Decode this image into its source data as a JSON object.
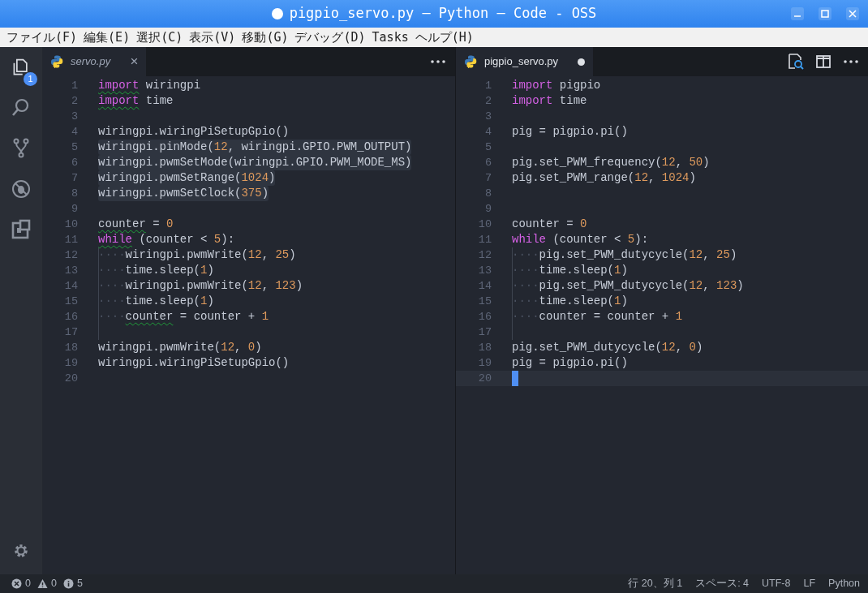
{
  "window": {
    "title": "pigpio_servo.py — Python — Code - OSS",
    "dirty": true
  },
  "menu": [
    "ファイル(F)",
    "編集(E)",
    "選択(C)",
    "表示(V)",
    "移動(G)",
    "デバッグ(D)",
    "Tasks",
    "ヘルプ(H)"
  ],
  "activity_bar": {
    "items": [
      {
        "kind": "files",
        "selected": true,
        "badge": "1"
      },
      {
        "kind": "search",
        "selected": false
      },
      {
        "kind": "source-control",
        "selected": false
      },
      {
        "kind": "debug",
        "selected": false
      },
      {
        "kind": "extensions",
        "selected": false
      }
    ],
    "bottom": {
      "kind": "settings"
    }
  },
  "editors": [
    {
      "tab": {
        "label": "servo.py",
        "preview": true,
        "dirty": false,
        "close": "×"
      },
      "actions": [
        {
          "kind": "more"
        }
      ],
      "lines": [
        {
          "number": "1",
          "highlighted": false,
          "current": false,
          "guide": false,
          "tokens": [
            {
              "text": "import",
              "kind": "keyword",
              "warning": true
            },
            {
              "text": " wiringpi",
              "kind": "plain",
              "warning": false
            }
          ]
        },
        {
          "number": "2",
          "highlighted": false,
          "current": false,
          "guide": false,
          "tokens": [
            {
              "text": "import",
              "kind": "keyword",
              "warning": true
            },
            {
              "text": " time",
              "kind": "plain",
              "warning": false
            }
          ]
        },
        {
          "number": "3",
          "highlighted": false,
          "current": false,
          "guide": false
        },
        {
          "number": "4",
          "highlighted": false,
          "current": false,
          "guide": false,
          "tokens": [
            {
              "text": "wiringpi.wiringPiSetupGpio()",
              "kind": "plain",
              "warning": false
            }
          ]
        },
        {
          "number": "5",
          "highlighted": true,
          "current": false,
          "guide": false,
          "tokens": [
            {
              "text": "wiringpi.pinMode(",
              "kind": "plain",
              "warning": false
            },
            {
              "text": "12",
              "kind": "number",
              "warning": false
            },
            {
              "text": ", wiringpi.GPIO.PWM_OUTPUT)",
              "kind": "plain",
              "warning": false
            }
          ]
        },
        {
          "number": "6",
          "highlighted": true,
          "current": false,
          "guide": false,
          "tokens": [
            {
              "text": "wiringpi.pwmSetMode(wiringpi.GPIO.PWM_MODE_MS)",
              "kind": "plain",
              "warning": false
            }
          ]
        },
        {
          "number": "7",
          "highlighted": true,
          "current": false,
          "guide": false,
          "tokens": [
            {
              "text": "wiringpi.pwmSetRange(",
              "kind": "plain",
              "warning": false
            },
            {
              "text": "1024",
              "kind": "number",
              "warning": false
            },
            {
              "text": ")",
              "kind": "plain",
              "warning": false
            }
          ]
        },
        {
          "number": "8",
          "highlighted": true,
          "current": false,
          "guide": false,
          "tokens": [
            {
              "text": "wiringpi.pwmSetClock(",
              "kind": "plain",
              "warning": false
            },
            {
              "text": "375",
              "kind": "number",
              "warning": false
            },
            {
              "text": ")",
              "kind": "plain",
              "warning": false
            }
          ]
        },
        {
          "number": "9",
          "highlighted": false,
          "current": false,
          "guide": false
        },
        {
          "number": "10",
          "highlighted": false,
          "current": false,
          "guide": false,
          "tokens": [
            {
              "text": "counter",
              "kind": "plain",
              "warning": true
            },
            {
              "text": " = ",
              "kind": "plain",
              "warning": false
            },
            {
              "text": "0",
              "kind": "number",
              "warning": false
            }
          ]
        },
        {
          "number": "11",
          "highlighted": false,
          "current": false,
          "guide": false,
          "tokens": [
            {
              "text": "while",
              "kind": "keyword",
              "warning": true
            },
            {
              "text": " (counter < ",
              "kind": "plain",
              "warning": false
            },
            {
              "text": "5",
              "kind": "number",
              "warning": false
            },
            {
              "text": "):",
              "kind": "plain",
              "warning": false
            }
          ]
        },
        {
          "number": "12",
          "highlighted": false,
          "current": false,
          "guide": true,
          "tokens": [
            {
              "text": "····",
              "kind": "whitespace",
              "warning": false
            },
            {
              "text": "wiringpi.pwmWrite(",
              "kind": "plain",
              "warning": false
            },
            {
              "text": "12",
              "kind": "number",
              "warning": false
            },
            {
              "text": ", ",
              "kind": "plain",
              "warning": false
            },
            {
              "text": "25",
              "kind": "number",
              "warning": false
            },
            {
              "text": ")",
              "kind": "plain",
              "warning": false
            }
          ]
        },
        {
          "number": "13",
          "highlighted": false,
          "current": false,
          "guide": true,
          "tokens": [
            {
              "text": "····",
              "kind": "whitespace",
              "warning": false
            },
            {
              "text": "time.sleep(",
              "kind": "plain",
              "warning": false
            },
            {
              "text": "1",
              "kind": "number",
              "warning": false
            },
            {
              "text": ")",
              "kind": "plain",
              "warning": false
            }
          ]
        },
        {
          "number": "14",
          "highlighted": false,
          "current": false,
          "guide": true,
          "tokens": [
            {
              "text": "····",
              "kind": "whitespace",
              "warning": false
            },
            {
              "text": "wiringpi.pwmWrite(",
              "kind": "plain",
              "warning": false
            },
            {
              "text": "12",
              "kind": "number",
              "warning": false
            },
            {
              "text": ", ",
              "kind": "plain",
              "warning": false
            },
            {
              "text": "123",
              "kind": "number",
              "warning": false
            },
            {
              "text": ")",
              "kind": "plain",
              "warning": false
            }
          ]
        },
        {
          "number": "15",
          "highlighted": false,
          "current": false,
          "guide": true,
          "tokens": [
            {
              "text": "····",
              "kind": "whitespace",
              "warning": false
            },
            {
              "text": "time.sleep(",
              "kind": "plain",
              "warning": false
            },
            {
              "text": "1",
              "kind": "number",
              "warning": false
            },
            {
              "text": ")",
              "kind": "plain",
              "warning": false
            }
          ]
        },
        {
          "number": "16",
          "highlighted": false,
          "current": false,
          "guide": true,
          "tokens": [
            {
              "text": "····",
              "kind": "whitespace",
              "warning": false
            },
            {
              "text": "counter",
              "kind": "plain",
              "warning": true
            },
            {
              "text": " = counter + ",
              "kind": "plain",
              "warning": false
            },
            {
              "text": "1",
              "kind": "number",
              "warning": false
            }
          ]
        },
        {
          "number": "17",
          "highlighted": false,
          "current": false,
          "guide": true
        },
        {
          "number": "18",
          "highlighted": false,
          "current": false,
          "guide": false,
          "tokens": [
            {
              "text": "wiringpi.pwmWrite(",
              "kind": "plain",
              "warning": false
            },
            {
              "text": "12",
              "kind": "number",
              "warning": false
            },
            {
              "text": ", ",
              "kind": "plain",
              "warning": false
            },
            {
              "text": "0",
              "kind": "number",
              "warning": false
            },
            {
              "text": ")",
              "kind": "plain",
              "warning": false
            }
          ]
        },
        {
          "number": "19",
          "highlighted": false,
          "current": false,
          "guide": false,
          "tokens": [
            {
              "text": "wiringpi.wiringPiSetupGpio()",
              "kind": "plain",
              "warning": false
            }
          ]
        },
        {
          "number": "20",
          "highlighted": false,
          "current": false,
          "guide": false
        }
      ]
    },
    {
      "tab": {
        "label": "pigpio_servo.py",
        "preview": false,
        "dirty": true
      },
      "actions": [
        {
          "kind": "preview"
        },
        {
          "kind": "split"
        },
        {
          "kind": "more"
        }
      ],
      "lines": [
        {
          "number": "1",
          "highlighted": false,
          "current": false,
          "guide": false,
          "tokens": [
            {
              "text": "import",
              "kind": "keyword",
              "warning": false
            },
            {
              "text": " pigpio",
              "kind": "plain",
              "warning": false
            }
          ]
        },
        {
          "number": "2",
          "highlighted": false,
          "current": false,
          "guide": false,
          "tokens": [
            {
              "text": "import",
              "kind": "keyword",
              "warning": false
            },
            {
              "text": " time",
              "kind": "plain",
              "warning": false
            }
          ]
        },
        {
          "number": "3",
          "highlighted": false,
          "current": false,
          "guide": false
        },
        {
          "number": "4",
          "highlighted": false,
          "current": false,
          "guide": false,
          "tokens": [
            {
              "text": "pig = pigpio.pi()",
              "kind": "plain",
              "warning": false
            }
          ]
        },
        {
          "number": "5",
          "highlighted": false,
          "current": false,
          "guide": false
        },
        {
          "number": "6",
          "highlighted": false,
          "current": false,
          "guide": false,
          "tokens": [
            {
              "text": "pig.set_PWM_frequency(",
              "kind": "plain",
              "warning": false
            },
            {
              "text": "12",
              "kind": "number",
              "warning": false
            },
            {
              "text": ", ",
              "kind": "plain",
              "warning": false
            },
            {
              "text": "50",
              "kind": "number",
              "warning": false
            },
            {
              "text": ")",
              "kind": "plain",
              "warning": false
            }
          ]
        },
        {
          "number": "7",
          "highlighted": false,
          "current": false,
          "guide": false,
          "tokens": [
            {
              "text": "pig.set_PWM_range(",
              "kind": "plain",
              "warning": false
            },
            {
              "text": "12",
              "kind": "number",
              "warning": false
            },
            {
              "text": ", ",
              "kind": "plain",
              "warning": false
            },
            {
              "text": "1024",
              "kind": "number",
              "warning": false
            },
            {
              "text": ")",
              "kind": "plain",
              "warning": false
            }
          ]
        },
        {
          "number": "8",
          "highlighted": false,
          "current": false,
          "guide": false
        },
        {
          "number": "9",
          "highlighted": false,
          "current": false,
          "guide": false
        },
        {
          "number": "10",
          "highlighted": false,
          "current": false,
          "guide": false,
          "tokens": [
            {
              "text": "counter = ",
              "kind": "plain",
              "warning": false
            },
            {
              "text": "0",
              "kind": "number",
              "warning": false
            }
          ]
        },
        {
          "number": "11",
          "highlighted": false,
          "current": false,
          "guide": false,
          "tokens": [
            {
              "text": "while",
              "kind": "keyword",
              "warning": false
            },
            {
              "text": " (counter < ",
              "kind": "plain",
              "warning": false
            },
            {
              "text": "5",
              "kind": "number",
              "warning": false
            },
            {
              "text": "):",
              "kind": "plain",
              "warning": false
            }
          ]
        },
        {
          "number": "12",
          "highlighted": false,
          "current": false,
          "guide": true,
          "tokens": [
            {
              "text": "····",
              "kind": "whitespace",
              "warning": false
            },
            {
              "text": "pig.set_PWM_dutycycle(",
              "kind": "plain",
              "warning": false
            },
            {
              "text": "12",
              "kind": "number",
              "warning": false
            },
            {
              "text": ", ",
              "kind": "plain",
              "warning": false
            },
            {
              "text": "25",
              "kind": "number",
              "warning": false
            },
            {
              "text": ")",
              "kind": "plain",
              "warning": false
            }
          ]
        },
        {
          "number": "13",
          "highlighted": false,
          "current": false,
          "guide": true,
          "tokens": [
            {
              "text": "····",
              "kind": "whitespace",
              "warning": false
            },
            {
              "text": "time.sleep(",
              "kind": "plain",
              "warning": false
            },
            {
              "text": "1",
              "kind": "number",
              "warning": false
            },
            {
              "text": ")",
              "kind": "plain",
              "warning": false
            }
          ]
        },
        {
          "number": "14",
          "highlighted": false,
          "current": false,
          "guide": true,
          "tokens": [
            {
              "text": "····",
              "kind": "whitespace",
              "warning": false
            },
            {
              "text": "pig.set_PWM_dutycycle(",
              "kind": "plain",
              "warning": false
            },
            {
              "text": "12",
              "kind": "number",
              "warning": false
            },
            {
              "text": ", ",
              "kind": "plain",
              "warning": false
            },
            {
              "text": "123",
              "kind": "number",
              "warning": false
            },
            {
              "text": ")",
              "kind": "plain",
              "warning": false
            }
          ]
        },
        {
          "number": "15",
          "highlighted": false,
          "current": false,
          "guide": true,
          "tokens": [
            {
              "text": "····",
              "kind": "whitespace",
              "warning": false
            },
            {
              "text": "time.sleep(",
              "kind": "plain",
              "warning": false
            },
            {
              "text": "1",
              "kind": "number",
              "warning": false
            },
            {
              "text": ")",
              "kind": "plain",
              "warning": false
            }
          ]
        },
        {
          "number": "16",
          "highlighted": false,
          "current": false,
          "guide": true,
          "tokens": [
            {
              "text": "····",
              "kind": "whitespace",
              "warning": false
            },
            {
              "text": "counter = counter + ",
              "kind": "plain",
              "warning": false
            },
            {
              "text": "1",
              "kind": "number",
              "warning": false
            }
          ]
        },
        {
          "number": "17",
          "highlighted": false,
          "current": false,
          "guide": true
        },
        {
          "number": "18",
          "highlighted": false,
          "current": false,
          "guide": false,
          "tokens": [
            {
              "text": "pig.set_PWM_dutycycle(",
              "kind": "plain",
              "warning": false
            },
            {
              "text": "12",
              "kind": "number",
              "warning": false
            },
            {
              "text": ", ",
              "kind": "plain",
              "warning": false
            },
            {
              "text": "0",
              "kind": "number",
              "warning": false
            },
            {
              "text": ")",
              "kind": "plain",
              "warning": false
            }
          ]
        },
        {
          "number": "19",
          "highlighted": false,
          "current": false,
          "guide": false,
          "tokens": [
            {
              "text": "pig = pigpio.pi()",
              "kind": "plain",
              "warning": false
            }
          ]
        },
        {
          "number": "20",
          "highlighted": false,
          "current": true,
          "guide": false
        }
      ]
    }
  ],
  "status_bar": {
    "problems": [
      {
        "kind": "error",
        "count": "0"
      },
      {
        "kind": "warning",
        "count": "0"
      },
      {
        "kind": "info",
        "count": "5"
      }
    ],
    "items": [
      "行 20、列 1",
      "スペース: 4",
      "UTF-8",
      "LF",
      "Python"
    ]
  }
}
